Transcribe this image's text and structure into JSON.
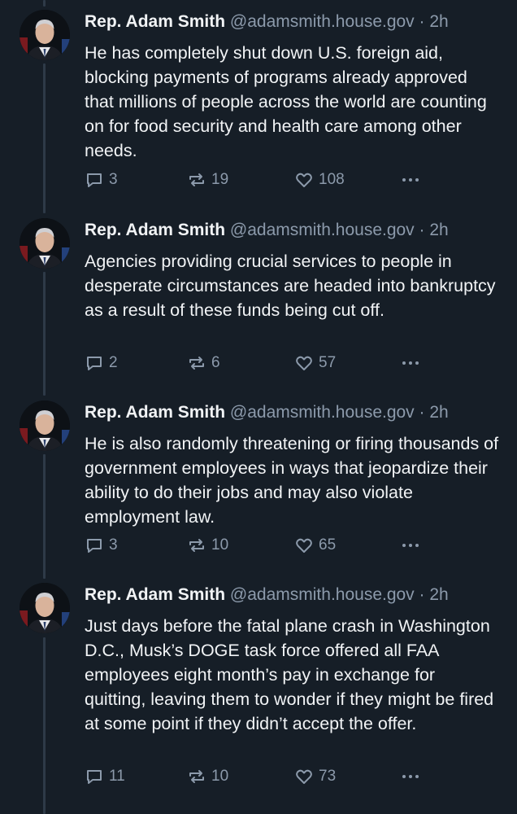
{
  "posts": [
    {
      "author_name": "Rep. Adam Smith",
      "handle": "@adamsmith.house.gov",
      "separator": "·",
      "time": "2h",
      "text": "He has completely shut down U.S. foreign aid, blocking payments of programs already approved that millions of people across the world are counting on for food security and health care among other needs.",
      "replies": "3",
      "reposts": "19",
      "likes": "108"
    },
    {
      "author_name": "Rep. Adam Smith",
      "handle": "@adamsmith.house.gov",
      "separator": "·",
      "time": "2h",
      "text": "Agencies providing crucial services to people in desperate circumstances are headed into bankruptcy as a result of these funds being cut off.",
      "replies": "2",
      "reposts": "6",
      "likes": "57"
    },
    {
      "author_name": "Rep. Adam Smith",
      "handle": "@adamsmith.house.gov",
      "separator": "·",
      "time": "2h",
      "text": "He is also randomly threatening or firing thousands of government employees in ways that jeopardize their ability to do their jobs and may also violate employment law.",
      "replies": "3",
      "reposts": "10",
      "likes": "65"
    },
    {
      "author_name": "Rep. Adam Smith",
      "handle": "@adamsmith.house.gov",
      "separator": "·",
      "time": "2h",
      "text": "Just days before the fatal plane crash in Washington D.C., Musk’s DOGE task force offered all FAA employees eight month’s pay in exchange for quitting, leaving them to wonder if they might be fired at some point if they didn’t accept the offer.",
      "replies": "11",
      "reposts": "10",
      "likes": "73"
    }
  ],
  "icons": {
    "reply": "speech-bubble-icon",
    "repost": "repost-arrows-icon",
    "like": "heart-icon",
    "more": "ellipsis-icon"
  },
  "colors": {
    "background": "#161e27",
    "text": "#f1f3f5",
    "muted": "#8c9aab",
    "thread_line": "#2e3a48"
  }
}
